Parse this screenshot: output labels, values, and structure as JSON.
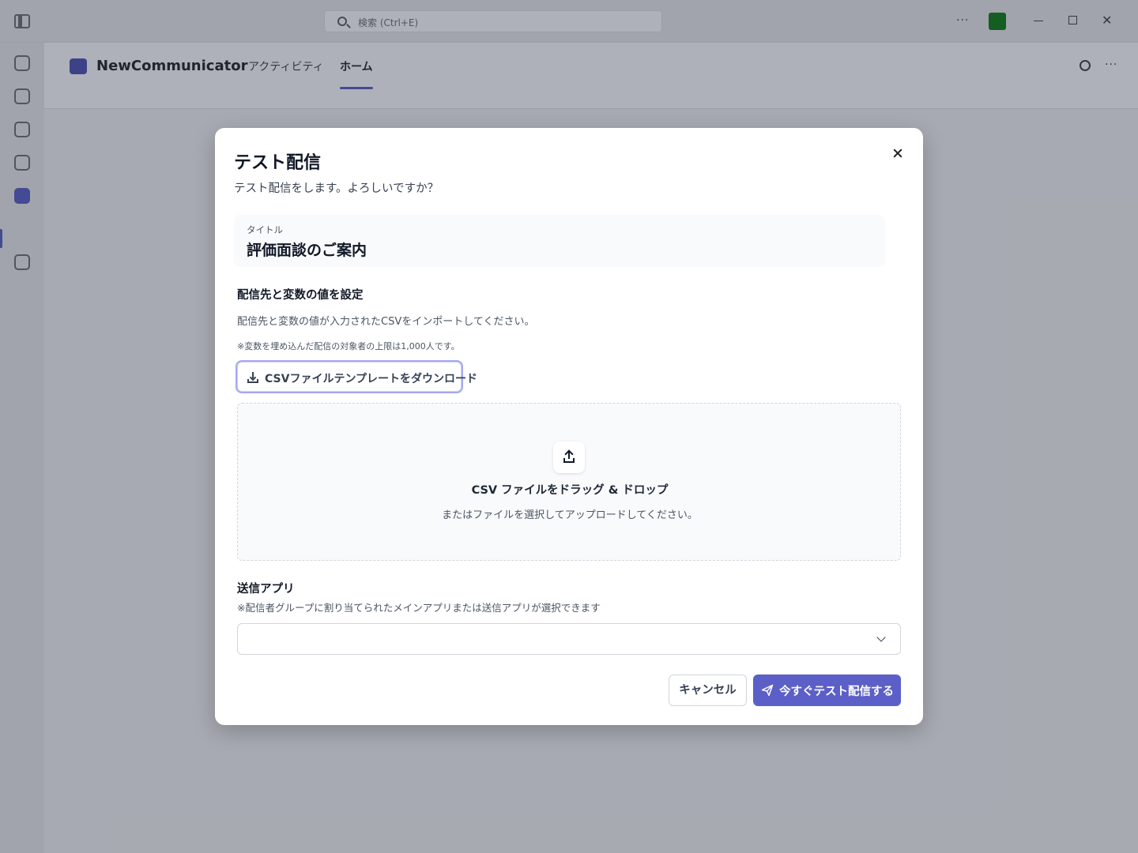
{
  "titlebar": {
    "search_placeholder": "検索 (Ctrl+E)",
    "more": "···"
  },
  "app": {
    "name": "NewCommunicator",
    "tabs": [
      {
        "label": "アクティビティ"
      },
      {
        "label": "ホーム",
        "active": true
      }
    ],
    "more": "···"
  },
  "dialog": {
    "title": "テスト配信",
    "description": "テスト配信をします。よろしいですか？",
    "title_field": {
      "label": "タイトル",
      "value": "評価面談のご案内"
    },
    "recipients": {
      "heading": "配信先と変数の値を設定",
      "description": "配信先と変数の値が入力されたCSVをインポートしてください。",
      "note": "※変数を埋め込んだ配信の対象者の上限は1,000人です。",
      "download_button": "CSVファイルテンプレートをダウンロード"
    },
    "dropzone": {
      "icon": "upload-icon",
      "title": "CSV ファイルをドラッグ & ドロップ",
      "description": "またはファイルを選択してアップロードしてください。"
    },
    "send_app": {
      "label": "送信アプリ",
      "note": "※配信者グループに割り当てられたメインアプリまたは送信アプリが選択できます",
      "value": ""
    },
    "buttons": {
      "cancel": "キャンセル",
      "submit": "今すぐテスト配信する"
    }
  },
  "colors": {
    "primary": "#5b5fc7",
    "focus_ring": "#a5a9f0",
    "avatar": "#107c10"
  }
}
